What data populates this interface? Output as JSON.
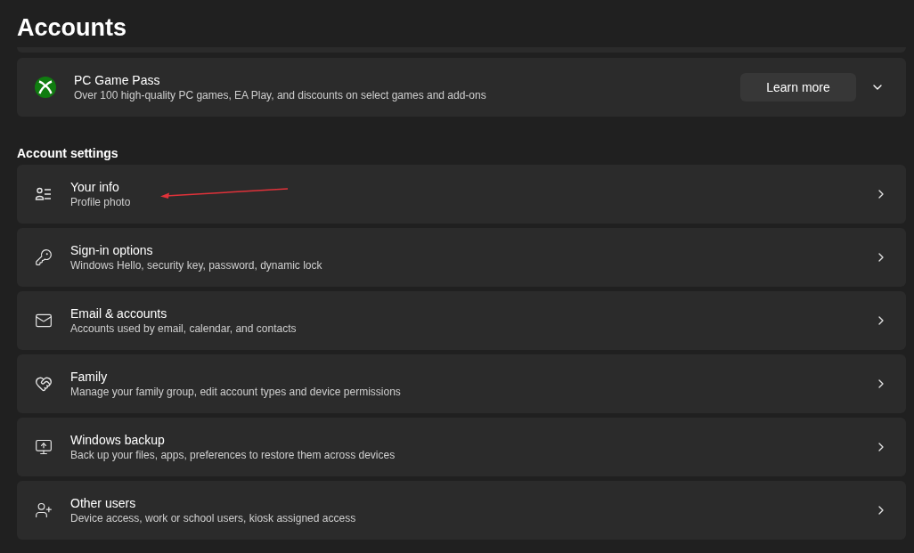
{
  "page_title": "Accounts",
  "promo": {
    "title": "PC Game Pass",
    "description": "Over 100 high-quality PC games, EA Play, and discounts on select games and add-ons",
    "button": "Learn more",
    "expanded": false
  },
  "section_title": "Account settings",
  "items": [
    {
      "kind": "info",
      "title": "Your info",
      "description": "Profile photo"
    },
    {
      "kind": "key",
      "title": "Sign-in options",
      "description": "Windows Hello, security key, password, dynamic lock"
    },
    {
      "kind": "mail",
      "title": "Email & accounts",
      "description": "Accounts used by email, calendar, and contacts"
    },
    {
      "kind": "family",
      "title": "Family",
      "description": "Manage your family group, edit account types and device permissions"
    },
    {
      "kind": "backup",
      "title": "Windows backup",
      "description": "Back up your files, apps, preferences to restore them across devices"
    },
    {
      "kind": "users",
      "title": "Other users",
      "description": "Device access, work or school users, kiosk assigned access"
    }
  ]
}
